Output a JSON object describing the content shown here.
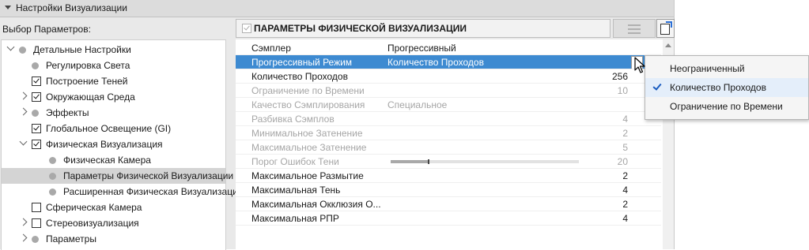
{
  "panel": {
    "title": "Настройки Визуализации",
    "selection_label": "Выбор Параметров:"
  },
  "tree": [
    {
      "label": "Детальные Настройки",
      "depth": 0,
      "expander": "down",
      "marker": "dot",
      "selected": false
    },
    {
      "label": "Регулировка Света",
      "depth": 1,
      "expander": "none",
      "marker": "dot",
      "selected": false
    },
    {
      "label": "Построение Теней",
      "depth": 1,
      "expander": "none",
      "marker": "checkbox-on",
      "selected": false
    },
    {
      "label": "Окружающая Среда",
      "depth": 1,
      "expander": "right",
      "marker": "checkbox-on",
      "selected": false
    },
    {
      "label": "Эффекты",
      "depth": 1,
      "expander": "right",
      "marker": "dot",
      "selected": false
    },
    {
      "label": "Глобальное Освещение (GI)",
      "depth": 1,
      "expander": "none",
      "marker": "checkbox-on",
      "selected": false
    },
    {
      "label": "Физическая Визуализация",
      "depth": 1,
      "expander": "down",
      "marker": "checkbox-on",
      "selected": false
    },
    {
      "label": "Физическая Камера",
      "depth": 2,
      "expander": "none",
      "marker": "dot",
      "selected": false
    },
    {
      "label": "Параметры Физической Визуализации",
      "depth": 2,
      "expander": "none",
      "marker": "dot",
      "selected": true
    },
    {
      "label": "Расширенная Физическая Визуализация",
      "depth": 2,
      "expander": "none",
      "marker": "dot",
      "selected": false
    },
    {
      "label": "Сферическая Камера",
      "depth": 1,
      "expander": "none",
      "marker": "checkbox-off",
      "selected": false
    },
    {
      "label": "Стереовизуализация",
      "depth": 1,
      "expander": "right",
      "marker": "checkbox-off",
      "selected": false
    },
    {
      "label": "Параметры",
      "depth": 1,
      "expander": "right",
      "marker": "dot",
      "selected": false
    }
  ],
  "section": {
    "title": "ПАРАМЕТРЫ ФИЗИЧЕСКОЙ ВИЗУАЛИЗАЦИИ"
  },
  "properties": [
    {
      "name": "Сэмплер",
      "value": "Прогрессивный",
      "right": "",
      "state": "normal",
      "slider": null
    },
    {
      "name": "Прогрессивный Режим",
      "value": "Количество Проходов",
      "right": "",
      "state": "highlight",
      "slider": null
    },
    {
      "name": "Количество Проходов",
      "value": "",
      "right": "256",
      "state": "normal",
      "slider": null
    },
    {
      "name": "Ограничение по Времени",
      "value": "",
      "right": "10",
      "state": "disabled",
      "slider": null
    },
    {
      "name": "Качество Сэмплирования",
      "value": "Специальное",
      "right": "",
      "state": "disabled",
      "slider": null
    },
    {
      "name": "Разбивка Сэмплов",
      "value": "",
      "right": "4",
      "state": "disabled",
      "slider": null
    },
    {
      "name": "Минимальное Затенение",
      "value": "",
      "right": "2",
      "state": "disabled",
      "slider": null
    },
    {
      "name": "Максимальное Затенение",
      "value": "",
      "right": "5",
      "state": "disabled",
      "slider": null
    },
    {
      "name": "Порог Ошибок Тени",
      "value": "",
      "right": "20",
      "state": "disabled",
      "slider": 0.2
    },
    {
      "name": "Максимальное Размытие",
      "value": "",
      "right": "2",
      "state": "normal",
      "slider": null
    },
    {
      "name": "Максимальная Тень",
      "value": "",
      "right": "4",
      "state": "normal",
      "slider": null
    },
    {
      "name": "Максимальная Окклюзия О...",
      "value": "",
      "right": "2",
      "state": "normal",
      "slider": null
    },
    {
      "name": "Максимальная РПР",
      "value": "",
      "right": "4",
      "state": "normal",
      "slider": null
    }
  ],
  "dropdown": {
    "options": [
      "Неограниченный",
      "Количество Проходов",
      "Ограничение по Времени"
    ],
    "selected_index": 1
  },
  "colors": {
    "highlight": "#3d8ad1",
    "check_accent": "#1a5cc0"
  },
  "icons": {
    "collapse": "triangle-down-icon",
    "list_view": "list-icon",
    "export": "export-doc-icon",
    "cursor": "arrow-cursor-icon"
  }
}
